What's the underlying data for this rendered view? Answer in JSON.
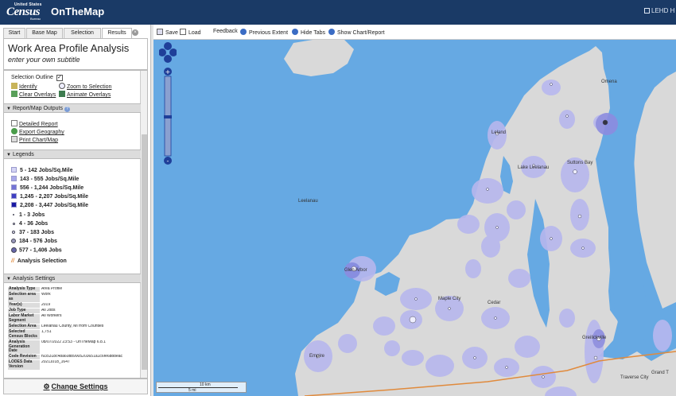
{
  "header": {
    "logo_top": "United States",
    "logo_main": "Census",
    "logo_bottom": "Bureau",
    "app_title": "OnTheMap",
    "right_link": "LEHD H"
  },
  "tabs": [
    {
      "label": "Start"
    },
    {
      "label": "Base Map"
    },
    {
      "label": "Selection"
    },
    {
      "label": "Results"
    }
  ],
  "results": {
    "title": "Work Area Profile Analysis",
    "subtitle": "enter your own subtitle",
    "selection_outline_label": "Selection Outline",
    "selection_outline_checked": "✓",
    "links": {
      "identify": "Identify",
      "zoom_to_selection": "Zoom to Selection",
      "clear_overlays": "Clear Overlays",
      "animate_overlays": "Animate Overlays"
    },
    "report_outputs": {
      "header": "Report/Map Outputs",
      "detailed_report": "Detailed Report",
      "export_geography": "Export Geography",
      "print_chart_map": "Print Chart/Map"
    },
    "legends": {
      "header": "Legends",
      "density": [
        {
          "label": "5 - 142  Jobs/Sq.Mile",
          "color": "#d4d4f5"
        },
        {
          "label": "143 - 555  Jobs/Sq.Mile",
          "color": "#a9a9ea"
        },
        {
          "label": "556 - 1,244  Jobs/Sq.Mile",
          "color": "#7373d6"
        },
        {
          "label": "1,245 - 2,207  Jobs/Sq.Mile",
          "color": "#3f3fc2"
        },
        {
          "label": "2,208 - 3,447  Jobs/Sq.Mile",
          "color": "#1a1aa3"
        }
      ],
      "points": [
        {
          "label": "1 - 3 Jobs"
        },
        {
          "label": "4 - 36 Jobs"
        },
        {
          "label": "37 - 183 Jobs"
        },
        {
          "label": "184 - 576 Jobs"
        },
        {
          "label": "577 - 1,406 Jobs"
        }
      ],
      "analysis_selection": "Analysis Selection"
    },
    "settings": {
      "header": "Analysis Settings",
      "rows": [
        {
          "k": "Analysis Type",
          "v": "Area Profile"
        },
        {
          "k": "Selection area as",
          "v": "Work"
        },
        {
          "k": "Year(s)",
          "v": "2019"
        },
        {
          "k": "Job Type",
          "v": "All Jobs"
        },
        {
          "k": "Labor Market Segment",
          "v": "All Workers"
        },
        {
          "k": "Selection Area",
          "v": "Leelanau County, MI from Counties"
        },
        {
          "k": "Selected Census Blocks",
          "v": "1,751"
        },
        {
          "k": "Analysis Generation Date",
          "v": "08/07/2022 23:53 - OnTheMap 6.8.1"
        },
        {
          "k": "Code Revision",
          "v": "f935318c48a60bb9905203651a1c6fe6bbbeac"
        },
        {
          "k": "LODES Data Version",
          "v": "20211018_1647"
        }
      ]
    },
    "change_settings": "Change Settings"
  },
  "toolbar": {
    "save": "Save",
    "load": "Load",
    "feedback": "Feedback",
    "previous_extent": "Previous Extent",
    "hide_tabs": "Hide Tabs",
    "show_chart_report": "Show Chart/Report"
  },
  "map": {
    "labels": {
      "omena": "Omena",
      "leland": "Leland",
      "suttons_bay": "Suttons Bay",
      "lake_leelanau": "Lake Leelanau",
      "leelanau": "Leelanau",
      "glen_arbor": "Glen Arbor",
      "maple_city": "Maple City",
      "cedar": "Cedar",
      "greilickville": "Greilickville",
      "empire": "Empire",
      "traverse_city": "Traverse City",
      "grand": "Grand T"
    },
    "scale": {
      "km": "10 km",
      "mi": "5 mi"
    }
  },
  "colors": {
    "header_bg": "#1a3a66",
    "water": "#66a9e3",
    "land": "#d9d9d9",
    "density": "#b7b7ee",
    "road": "#e08a3c"
  }
}
